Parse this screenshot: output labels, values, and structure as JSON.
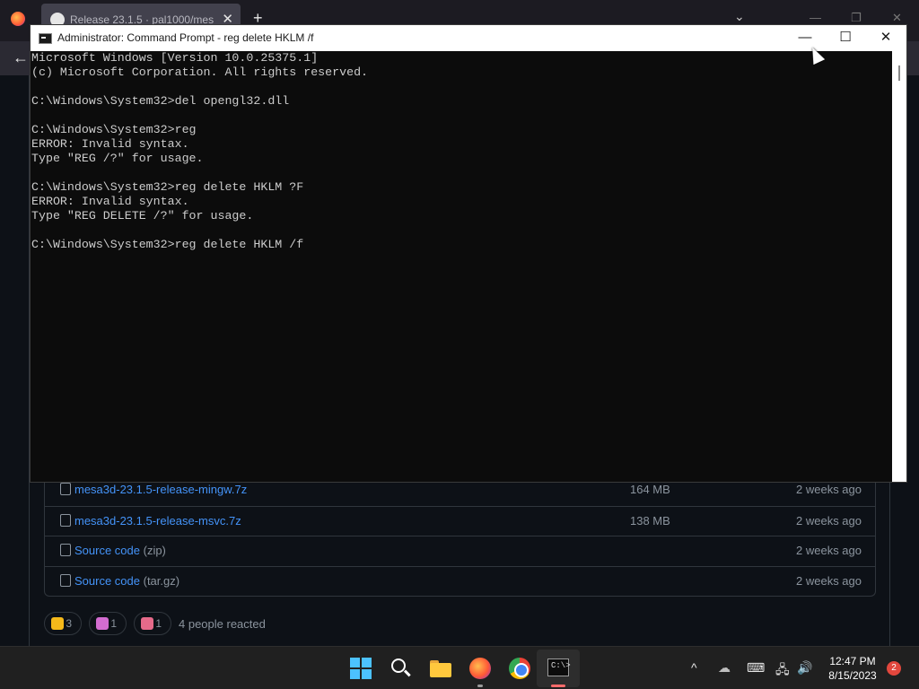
{
  "browser": {
    "tab_title": "Release 23.1.5 · pal1000/mesa-…",
    "tab_close": "✕",
    "new_tab": "+",
    "tab_list": "⌄",
    "win_min": "—",
    "win_restore": "❐",
    "win_close": "✕",
    "back": "←"
  },
  "assets": [
    {
      "name": "mesa3d-23.1.5-release-mingw.7z",
      "suffix": "",
      "size": "164 MB",
      "date": "2 weeks ago",
      "icon": "package-icon"
    },
    {
      "name": "mesa3d-23.1.5-release-msvc.7z",
      "suffix": "",
      "size": "138 MB",
      "date": "2 weeks ago",
      "icon": "package-icon"
    },
    {
      "name": "Source code",
      "suffix": " (zip)",
      "size": "",
      "date": "2 weeks ago",
      "icon": "file-zip-icon"
    },
    {
      "name": "Source code",
      "suffix": " (tar.gz)",
      "size": "",
      "date": "2 weeks ago",
      "icon": "file-zip-icon"
    }
  ],
  "reactions": {
    "items": [
      {
        "emoji": "thumbs-up",
        "count": "3",
        "color": "#f5b91a"
      },
      {
        "emoji": "party-popper",
        "count": "1",
        "color": "#d36cd0"
      },
      {
        "emoji": "rocket",
        "count": "1",
        "color": "#e66a8a"
      }
    ],
    "summary": "4 people reacted"
  },
  "cmd": {
    "title": "Administrator:  Command Prompt - reg  delete HKLM /f",
    "minimize": "—",
    "maximize": "☐",
    "close": "✕",
    "lines": [
      "Microsoft Windows [Version 10.0.25375.1]",
      "(c) Microsoft Corporation. All rights reserved.",
      "",
      "C:\\Windows\\System32>del opengl32.dll",
      "",
      "C:\\Windows\\System32>reg",
      "ERROR: Invalid syntax.",
      "Type \"REG /?\" for usage.",
      "",
      "C:\\Windows\\System32>reg delete HKLM ?F",
      "ERROR: Invalid syntax.",
      "Type \"REG DELETE /?\" for usage.",
      "",
      "C:\\Windows\\System32>reg delete HKLM /f"
    ]
  },
  "taskbar": {
    "apps": [
      "start",
      "search",
      "file-explorer",
      "firefox",
      "chrome",
      "command-prompt"
    ],
    "cmd_prompt_glyph": "C:\\>",
    "tray": {
      "chevron": "^",
      "cloud": "☁",
      "keyboard": "⌨",
      "network": "🖧",
      "volume": "🔊"
    },
    "time": "12:47 PM",
    "date": "8/15/2023",
    "notifications": "2"
  }
}
